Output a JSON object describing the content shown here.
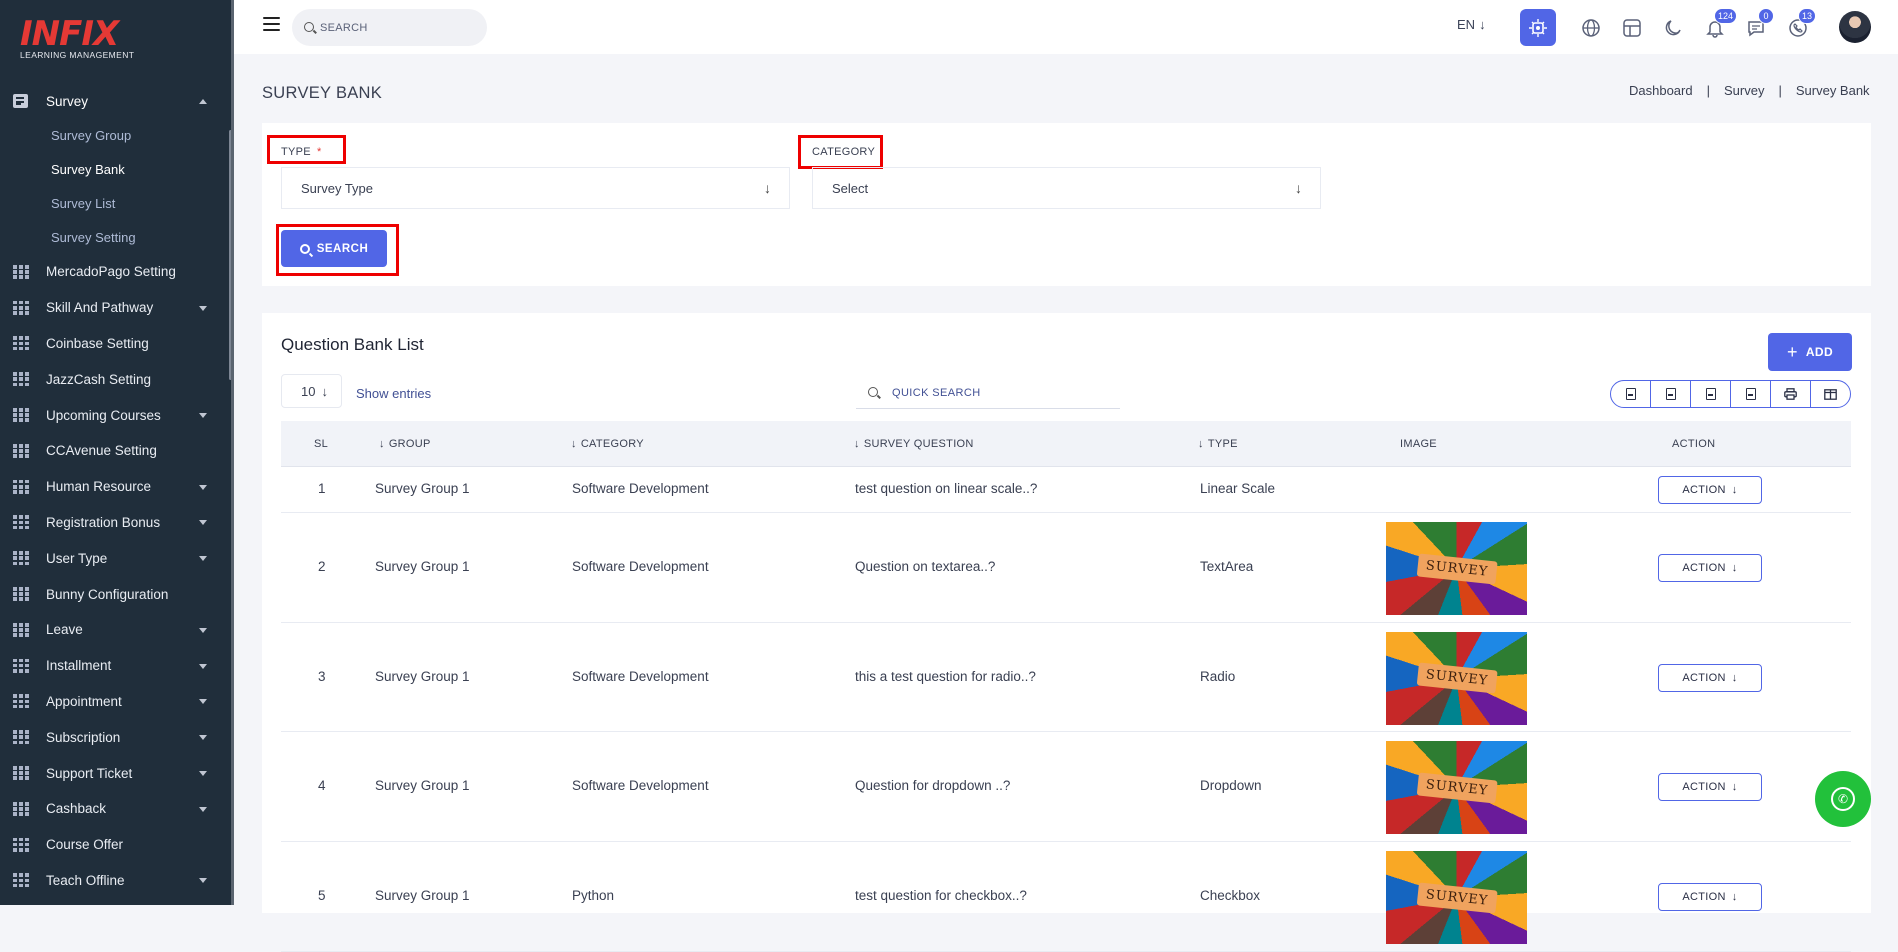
{
  "brand": {
    "logo_text": "INFIX",
    "logo_sub": "LEARNING MANAGEMENT"
  },
  "sidebar": {
    "survey": {
      "label": "Survey",
      "sub_items": [
        "Survey Group",
        "Survey Bank",
        "Survey List",
        "Survey Setting"
      ]
    },
    "items": [
      {
        "label": "MercadoPago Setting",
        "has_caret": false
      },
      {
        "label": "Skill And Pathway",
        "has_caret": true
      },
      {
        "label": "Coinbase Setting",
        "has_caret": false
      },
      {
        "label": "JazzCash Setting",
        "has_caret": false
      },
      {
        "label": "Upcoming Courses",
        "has_caret": true
      },
      {
        "label": "CCAvenue Setting",
        "has_caret": false
      },
      {
        "label": "Human Resource",
        "has_caret": true
      },
      {
        "label": "Registration Bonus",
        "has_caret": true
      },
      {
        "label": "User Type",
        "has_caret": true
      },
      {
        "label": "Bunny Configuration",
        "has_caret": false
      },
      {
        "label": "Leave",
        "has_caret": true
      },
      {
        "label": "Installment",
        "has_caret": true
      },
      {
        "label": "Appointment",
        "has_caret": true
      },
      {
        "label": "Subscription",
        "has_caret": true
      },
      {
        "label": "Support Ticket",
        "has_caret": true
      },
      {
        "label": "Cashback",
        "has_caret": true
      },
      {
        "label": "Course Offer",
        "has_caret": false
      },
      {
        "label": "Teach Offline",
        "has_caret": true
      }
    ]
  },
  "topbar": {
    "search_placeholder": "SEARCH",
    "lang": "EN",
    "lang_arrow": "↓",
    "notifications_count": "124",
    "messages_count": "0",
    "calls_count": "13"
  },
  "page": {
    "title": "SURVEY BANK",
    "breadcrumb": [
      "Dashboard",
      "|",
      "Survey",
      "|",
      "Survey Bank"
    ]
  },
  "filter": {
    "type_label": "TYPE",
    "required_mark": "*",
    "type_placeholder": "Survey Type",
    "category_label": "CATEGORY",
    "category_placeholder": "Select",
    "arrow": "↓",
    "search_button": "SEARCH"
  },
  "list": {
    "title": "Question Bank List",
    "add_button": "ADD",
    "add_plus": "+",
    "per_page": "10",
    "show_entries": "Show entries",
    "quick_search": "QUICK SEARCH",
    "columns": [
      {
        "label": "SL",
        "sort": ""
      },
      {
        "label": "GROUP",
        "sort": "↓"
      },
      {
        "label": "CATEGORY",
        "sort": "↓"
      },
      {
        "label": "SURVEY QUESTION",
        "sort": "↓"
      },
      {
        "label": "TYPE",
        "sort": "↓"
      },
      {
        "label": "IMAGE",
        "sort": ""
      },
      {
        "label": "ACTION",
        "sort": ""
      }
    ],
    "action_label": "ACTION",
    "image_text": "SURVEY",
    "rows": [
      {
        "sl": "1",
        "group": "Survey Group 1",
        "category": "Software Development",
        "question": "test question on linear scale..?",
        "type": "Linear Scale",
        "has_image": false
      },
      {
        "sl": "2",
        "group": "Survey Group 1",
        "category": "Software Development",
        "question": "Question on textarea..?",
        "type": "TextArea",
        "has_image": true
      },
      {
        "sl": "3",
        "group": "Survey Group 1",
        "category": "Software Development",
        "question": "this a test question for radio..?",
        "type": "Radio",
        "has_image": true
      },
      {
        "sl": "4",
        "group": "Survey Group 1",
        "category": "Software Development",
        "question": "Question for dropdown ..?",
        "type": "Dropdown",
        "has_image": true
      },
      {
        "sl": "5",
        "group": "Survey Group 1",
        "category": "Python",
        "question": "test question for checkbox..?",
        "type": "Checkbox",
        "has_image": true
      }
    ]
  },
  "colors": {
    "sidebar_bg": "#202e3b",
    "accent": "#5166e6",
    "highlight": "#ee0000",
    "whatsapp": "#22c13b"
  }
}
